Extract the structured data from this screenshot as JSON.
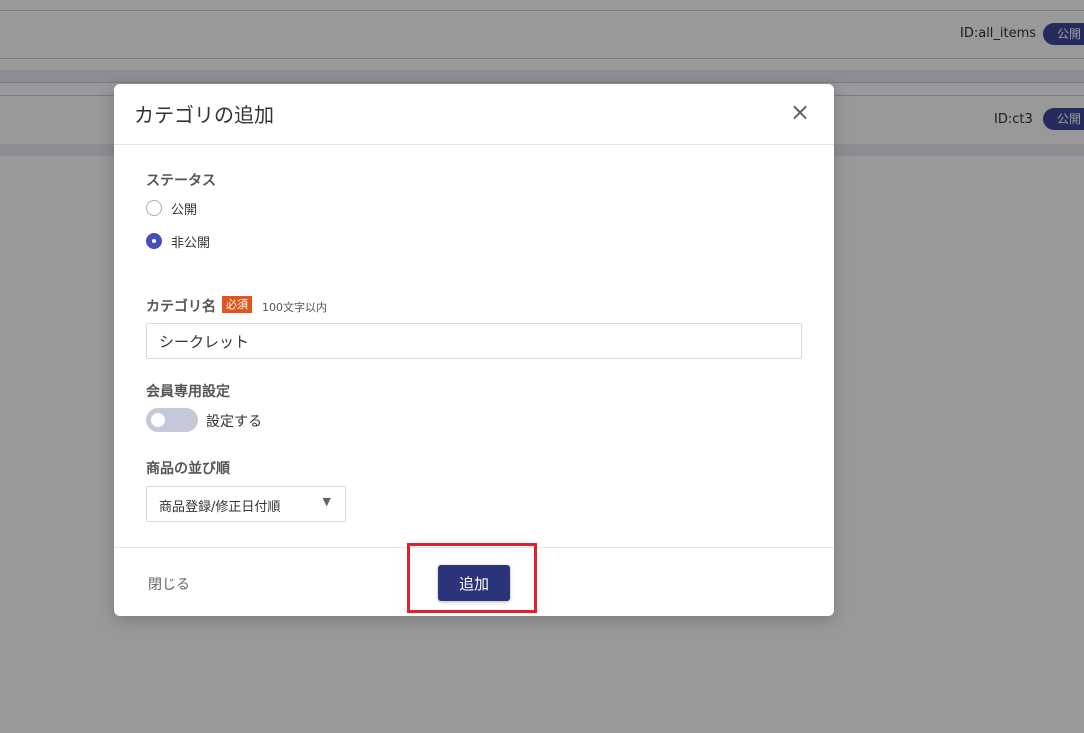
{
  "background": {
    "rows": [
      {
        "id": "ID:all_items",
        "badge": "公開"
      },
      {
        "id": "ID:ct3",
        "badge": "公開"
      }
    ]
  },
  "modal": {
    "title": "カテゴリの追加",
    "close_icon": "×",
    "status": {
      "label": "ステータス",
      "options": [
        {
          "label": "公開",
          "checked": false
        },
        {
          "label": "非公開",
          "checked": true
        }
      ]
    },
    "category_name": {
      "label": "カテゴリ名",
      "required_badge": "必須",
      "hint": "100文字以内",
      "value": "シークレット"
    },
    "member_only": {
      "label": "会員専用設定",
      "toggle_label": "設定する",
      "enabled": false
    },
    "sort_order": {
      "label": "商品の並び順",
      "selected": "商品登録/修正日付順"
    },
    "footer": {
      "close_label": "閉じる",
      "add_label": "追加"
    }
  },
  "colors": {
    "primary": "#2b337a",
    "accent": "#4450b8",
    "required": "#e0561e",
    "highlight": "#e0202c"
  }
}
